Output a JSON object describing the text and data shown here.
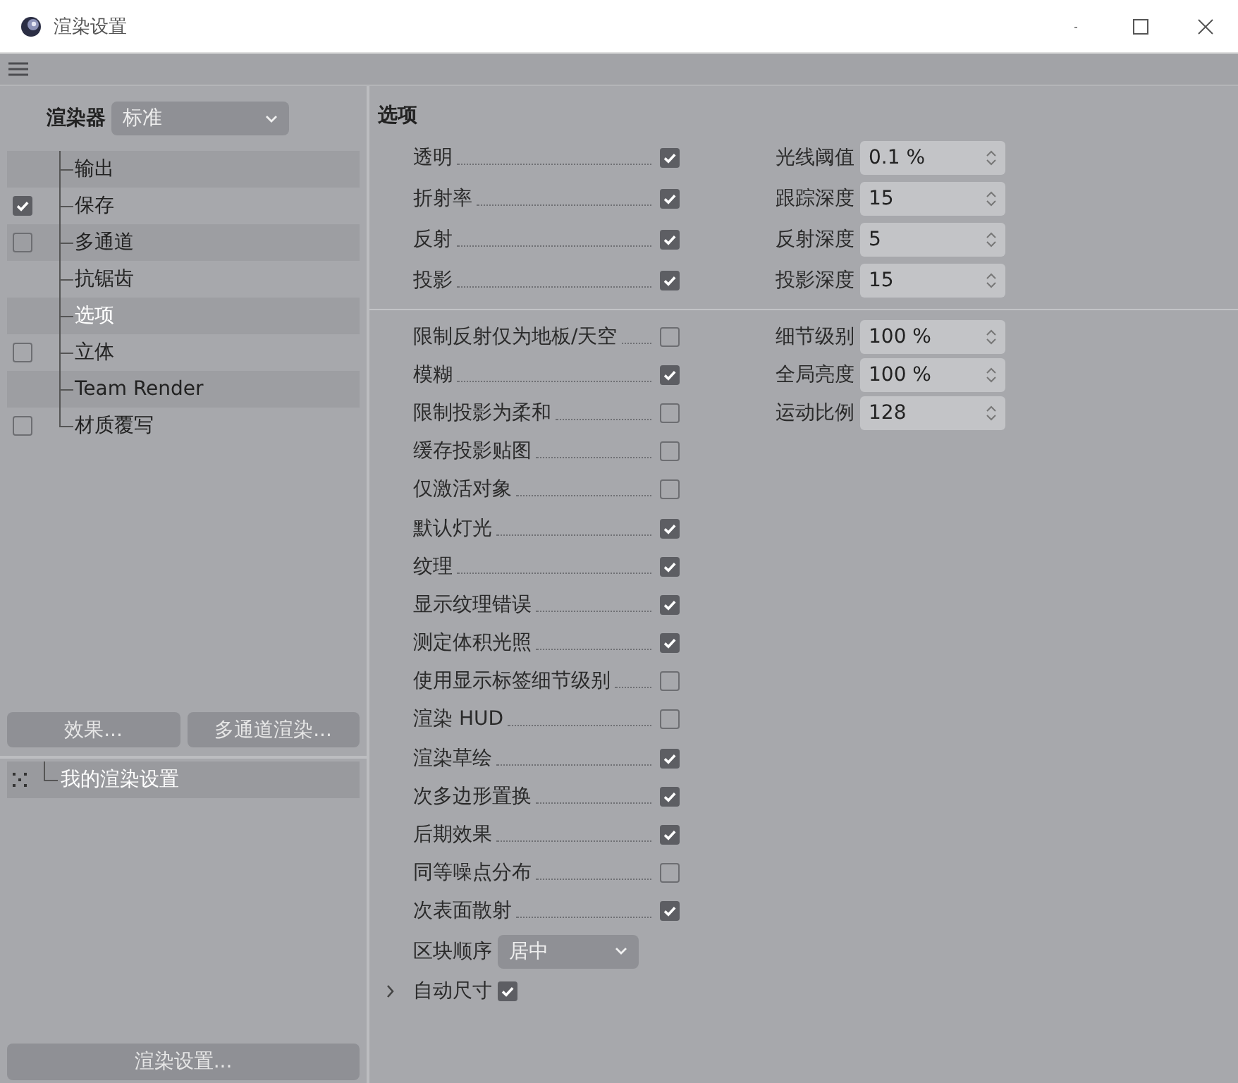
{
  "window": {
    "title": "渲染设置"
  },
  "renderer": {
    "label": "渲染器",
    "value": "标准"
  },
  "tree": [
    {
      "label": "输出",
      "kind": "plain",
      "selected": false
    },
    {
      "label": "保存",
      "kind": "check",
      "checked": true,
      "selected": false
    },
    {
      "label": "多通道",
      "kind": "check",
      "checked": false,
      "selected": false
    },
    {
      "label": "抗锯齿",
      "kind": "plain",
      "selected": false
    },
    {
      "label": "选项",
      "kind": "plain",
      "selected": true
    },
    {
      "label": "立体",
      "kind": "check",
      "checked": false,
      "selected": false
    },
    {
      "label": "Team Render",
      "kind": "plain",
      "selected": false
    },
    {
      "label": "材质覆写",
      "kind": "check",
      "checked": false,
      "selected": false
    }
  ],
  "effect_buttons": [
    "效果...",
    "多通道渲染..."
  ],
  "presets": [
    {
      "label": "我的渲染设置",
      "selected": true
    }
  ],
  "render_settings_button": "渲染设置...",
  "options": {
    "title": "选项",
    "section_1": [
      {
        "label": "透明",
        "checked": true,
        "field": {
          "label": "光线阈值",
          "value": "0.1 %"
        }
      },
      {
        "label": "折射率",
        "checked": true,
        "field": {
          "label": "跟踪深度",
          "value": "15"
        }
      },
      {
        "label": "反射",
        "checked": true,
        "field": {
          "label": "反射深度",
          "value": "5"
        }
      },
      {
        "label": "投影",
        "checked": true,
        "field": {
          "label": "投影深度",
          "value": "15"
        }
      }
    ],
    "section_2": [
      {
        "label": "限制反射仅为地板/天空",
        "checked": false,
        "field": {
          "label": "细节级别",
          "value": "100 %"
        }
      },
      {
        "label": "模糊",
        "checked": true,
        "field": {
          "label": "全局亮度",
          "value": "100 %"
        }
      },
      {
        "label": "限制投影为柔和",
        "checked": false,
        "field": {
          "label": "运动比例",
          "value": "128"
        }
      },
      {
        "label": "缓存投影贴图",
        "checked": false
      },
      {
        "label": "仅激活对象",
        "checked": false
      },
      {
        "label": "默认灯光",
        "checked": true
      },
      {
        "label": "纹理",
        "checked": true
      },
      {
        "label": "显示纹理错误",
        "checked": true
      },
      {
        "label": "测定体积光照",
        "checked": true
      },
      {
        "label": "使用显示标签细节级别",
        "checked": false
      },
      {
        "label": "渲染 HUD",
        "checked": false
      },
      {
        "label": "渲染草绘",
        "checked": true
      },
      {
        "label": "次多边形置换",
        "checked": true
      },
      {
        "label": "后期效果",
        "checked": true
      },
      {
        "label": "同等噪点分布",
        "checked": false
      },
      {
        "label": "次表面散射",
        "checked": true
      }
    ],
    "block_order": {
      "label": "区块顺序",
      "value": "居中"
    },
    "auto_size": {
      "label": "自动尺寸",
      "checked": true,
      "expanded": false
    }
  }
}
